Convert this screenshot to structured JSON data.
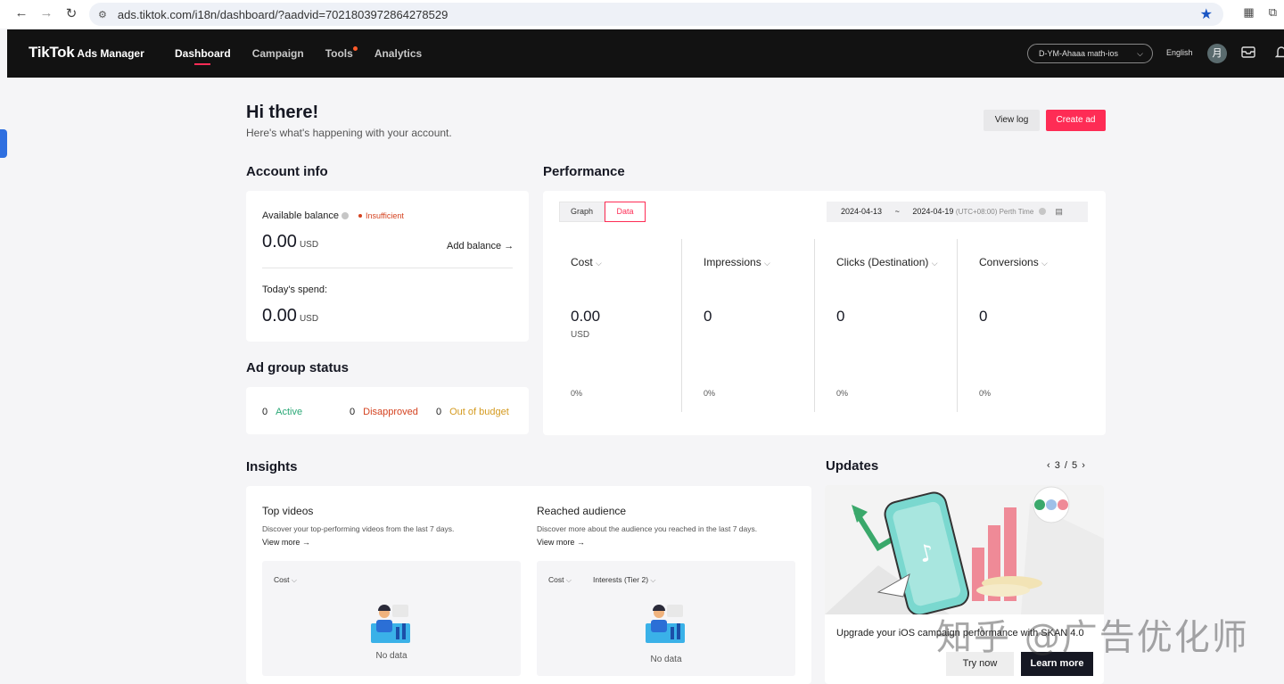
{
  "browser": {
    "back_icon": "←",
    "forward_icon": "→",
    "reload_icon": "↻",
    "url": "ads.tiktok.com/i18n/dashboard/?aadvid=7021803972864278529"
  },
  "header": {
    "logo_main": "TikTok",
    "logo_sub": "Ads Manager",
    "nav": [
      "Dashboard",
      "Campaign",
      "Tools",
      "Analytics"
    ],
    "account_select": "D-YM-Ahaaa math-ios",
    "language": "English",
    "avatar_initial": "月"
  },
  "greeting": {
    "title": "Hi there!",
    "subtitle": "Here's what's happening with your account.",
    "view_log": "View log",
    "create_ad": "Create ad"
  },
  "account_info": {
    "title": "Account info",
    "available_balance_label": "Available balance",
    "insufficient": "Insufficient",
    "balance_value": "0.00",
    "balance_unit": "USD",
    "add_balance": "Add balance →",
    "todays_spend_label": "Today's spend:",
    "spend_value": "0.00",
    "spend_unit": "USD"
  },
  "ad_group_status": {
    "title": "Ad group status",
    "items": [
      {
        "count": "0",
        "label": "Active"
      },
      {
        "count": "0",
        "label": "Disapproved"
      },
      {
        "count": "0",
        "label": "Out of budget"
      }
    ]
  },
  "performance": {
    "title": "Performance",
    "tabs": [
      "Graph",
      "Data"
    ],
    "active_tab": "Data",
    "date_start": "2024-04-13",
    "date_sep": "~",
    "date_end": "2024-04-19",
    "timezone": "(UTC+08:00) Perth Time",
    "metrics": [
      {
        "name": "Cost",
        "value": "0.00",
        "unit": "USD",
        "change": "0%"
      },
      {
        "name": "Impressions",
        "value": "0",
        "unit": "",
        "change": "0%"
      },
      {
        "name": "Clicks (Destination)",
        "value": "0",
        "unit": "",
        "change": "0%"
      },
      {
        "name": "Conversions",
        "value": "0",
        "unit": "",
        "change": "0%"
      }
    ]
  },
  "insights": {
    "title": "Insights",
    "top_videos": {
      "title": "Top videos",
      "desc": "Discover your top-performing videos from the last 7 days.",
      "more": "View more →",
      "filter": "Cost",
      "empty": "No data"
    },
    "reached_audience": {
      "title": "Reached audience",
      "desc": "Discover more about the audience you reached in the last 7 days.",
      "more": "View more →",
      "filter1": "Cost",
      "filter2": "Interests (Tier 2)",
      "empty": "No data"
    }
  },
  "updates": {
    "title": "Updates",
    "pager": "3 / 5",
    "promo_text": "Upgrade your iOS campaign performance with SKAN 4.0",
    "try_now": "Try now",
    "learn_more": "Learn more"
  },
  "watermark": "知乎 @广告优化师",
  "colors": {
    "brand": "#fe2c55",
    "header_bg": "#121212"
  }
}
